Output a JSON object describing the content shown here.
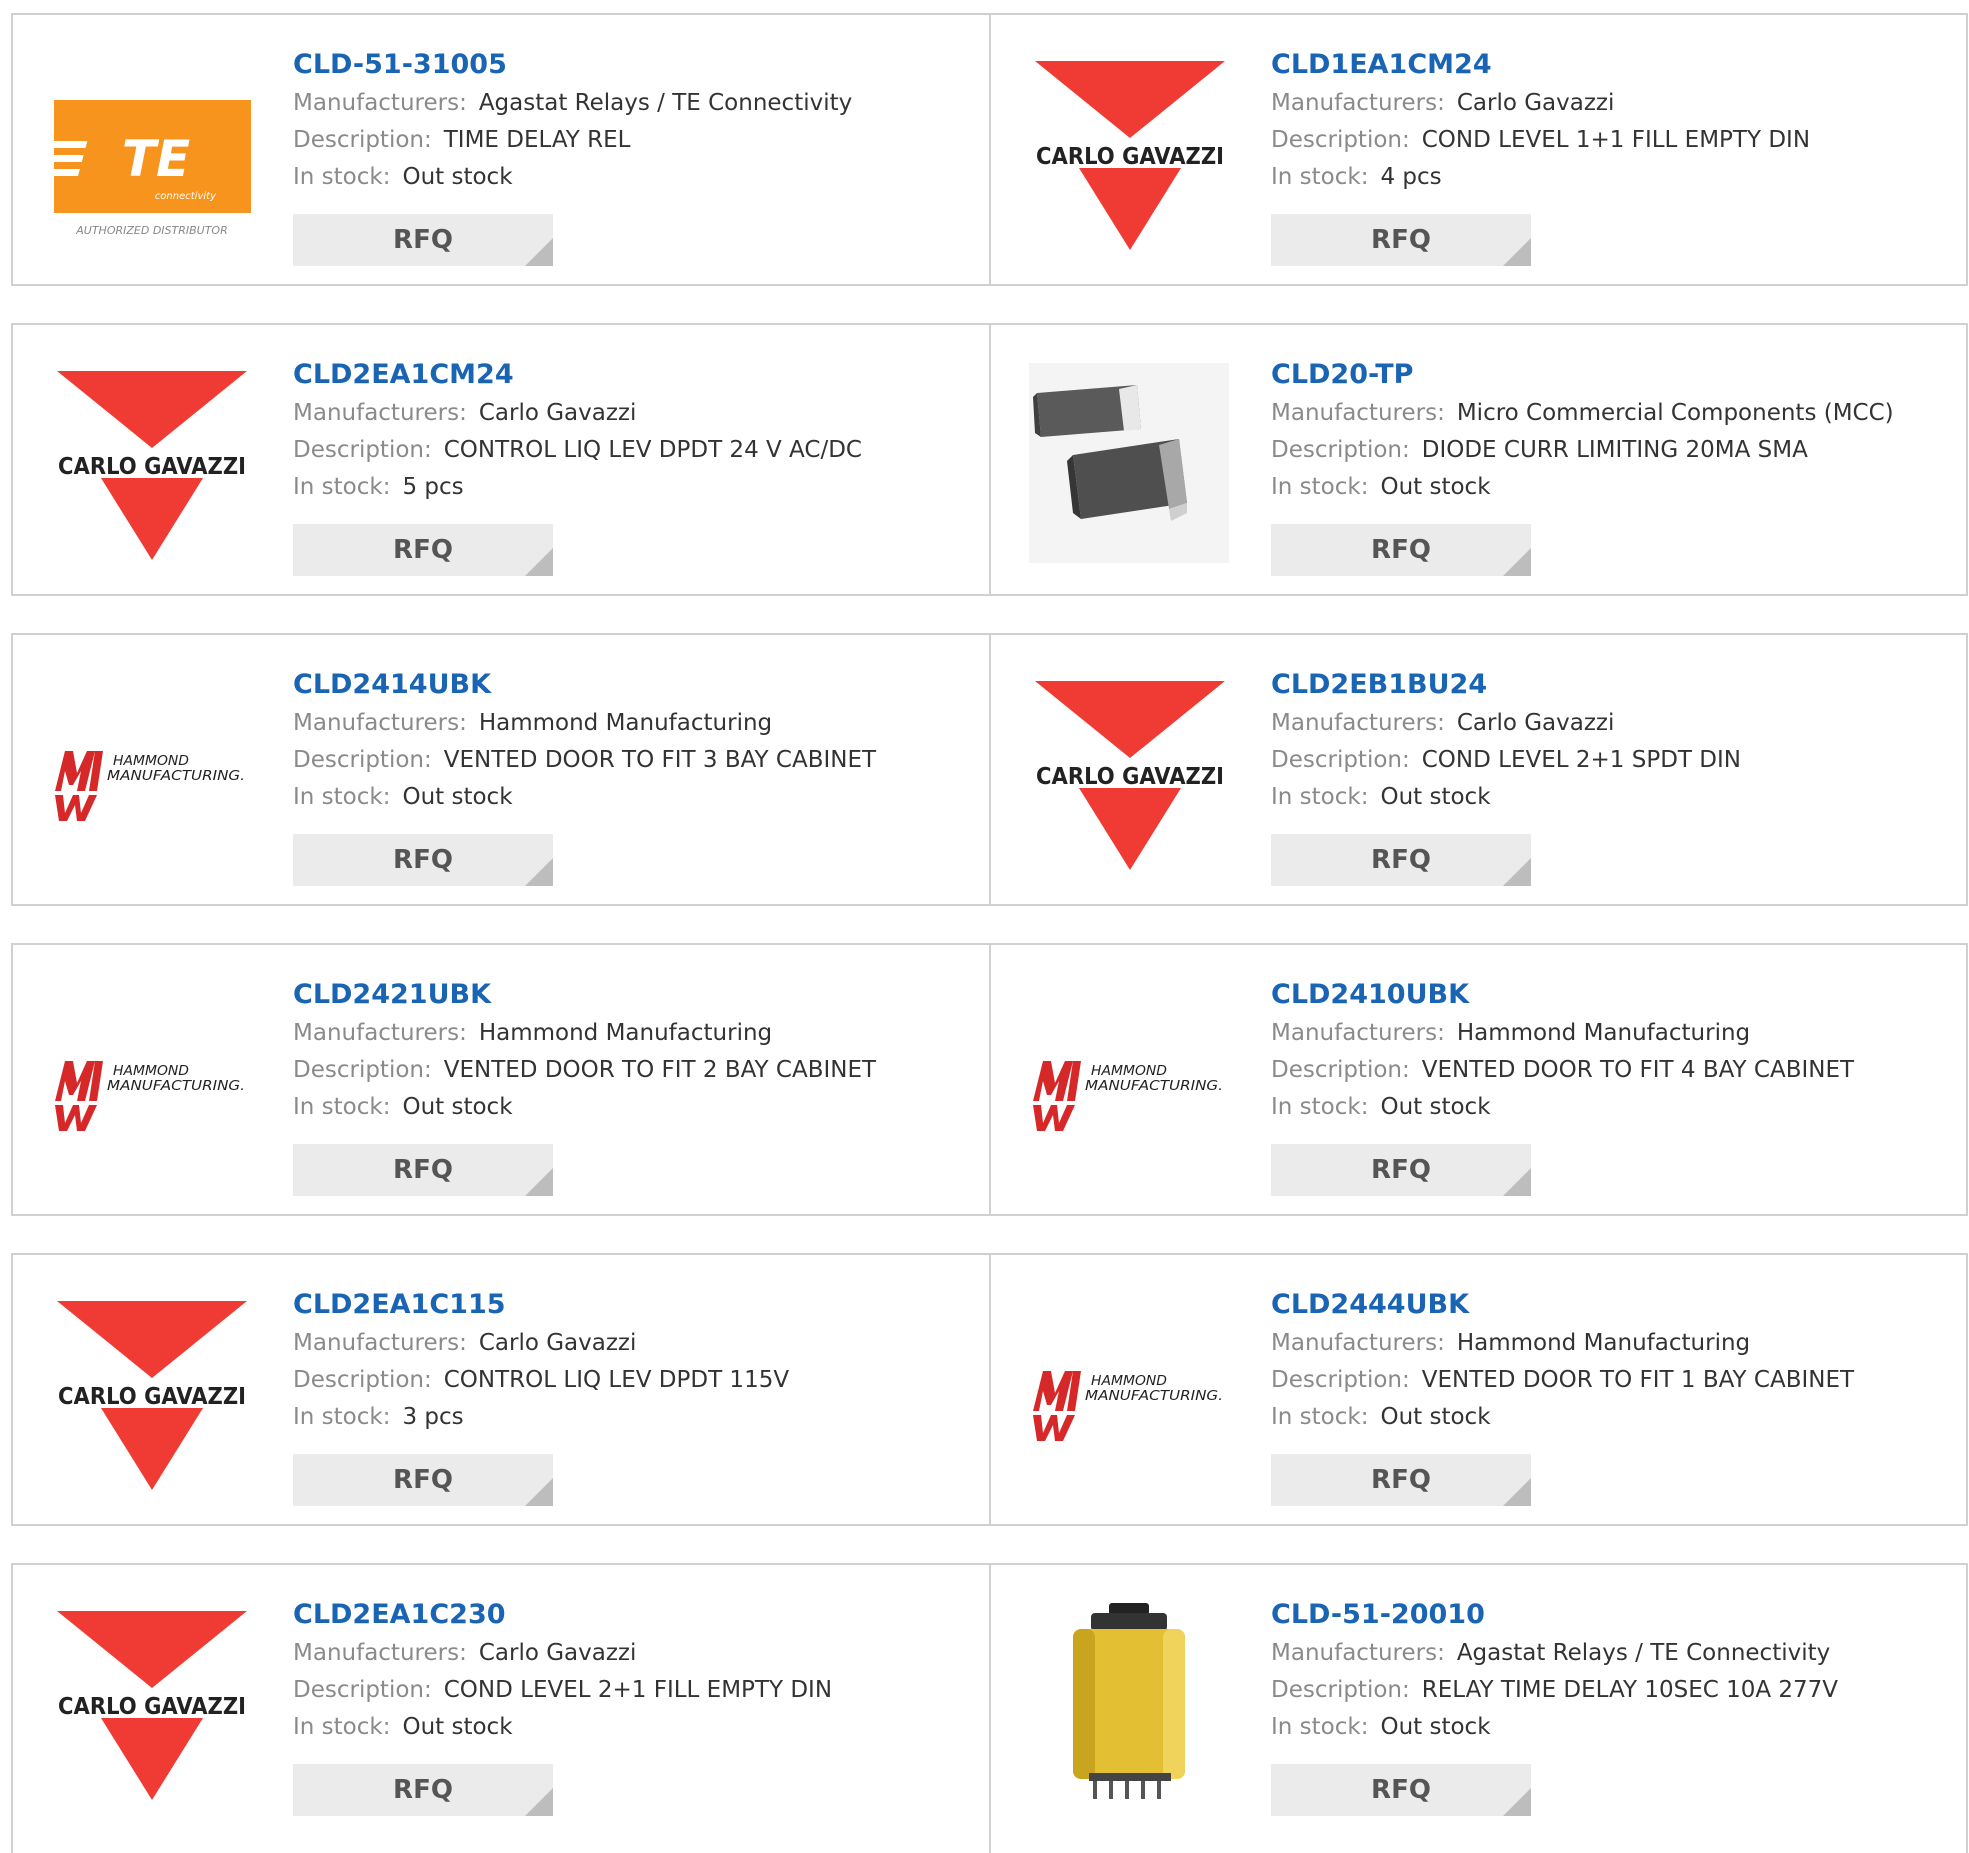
{
  "labels": {
    "manufacturers": "Manufacturers:",
    "description": "Description:",
    "in_stock": "In stock:",
    "rfq": "RFQ"
  },
  "logos": {
    "te": {
      "icon": "te-connectivity-logo",
      "mark": "TE",
      "sub": "connectivity",
      "tagline": "AUTHORIZED DISTRIBUTOR",
      "color": "#f7941d"
    },
    "carlo": {
      "icon": "carlo-gavazzi-logo",
      "text": "CARLO GAVAZZI",
      "color": "#ef3b33"
    },
    "hammond": {
      "icon": "hammond-manufacturing-logo",
      "line1": "HAMMOND",
      "line2": "MANUFACTURING.",
      "color": "#d62828"
    },
    "diode": {
      "icon": "sma-diode-image"
    },
    "relay": {
      "icon": "yellow-relay-image"
    }
  },
  "colors": {
    "link": "#1a64b4",
    "label": "#8a8a8a",
    "value": "#333333",
    "button_bg": "#ebebeb",
    "border": "#d0d0d0"
  },
  "products": [
    {
      "part": "CLD-51-31005",
      "logo": "te",
      "manufacturer": "Agastat Relays / TE Connectivity",
      "description": "TIME DELAY REL",
      "stock": "Out stock"
    },
    {
      "part": "CLD1EA1CM24",
      "logo": "carlo",
      "manufacturer": "Carlo Gavazzi",
      "description": "COND LEVEL 1+1 FILL EMPTY DIN",
      "stock": "4 pcs"
    },
    {
      "part": "CLD2EA1CM24",
      "logo": "carlo",
      "manufacturer": "Carlo Gavazzi",
      "description": "CONTROL LIQ LEV DPDT 24 V AC/DC",
      "stock": "5 pcs"
    },
    {
      "part": "CLD20-TP",
      "logo": "diode",
      "manufacturer": "Micro Commercial Components (MCC)",
      "description": "DIODE CURR LIMITING 20MA SMA",
      "stock": "Out stock"
    },
    {
      "part": "CLD2414UBK",
      "logo": "hammond",
      "manufacturer": "Hammond Manufacturing",
      "description": "VENTED DOOR TO FIT 3 BAY CABINET",
      "stock": "Out stock"
    },
    {
      "part": "CLD2EB1BU24",
      "logo": "carlo",
      "manufacturer": "Carlo Gavazzi",
      "description": "COND LEVEL 2+1 SPDT DIN",
      "stock": "Out stock"
    },
    {
      "part": "CLD2421UBK",
      "logo": "hammond",
      "manufacturer": "Hammond Manufacturing",
      "description": "VENTED DOOR TO FIT 2 BAY CABINET",
      "stock": "Out stock"
    },
    {
      "part": "CLD2410UBK",
      "logo": "hammond",
      "manufacturer": "Hammond Manufacturing",
      "description": "VENTED DOOR TO FIT 4 BAY CABINET",
      "stock": "Out stock"
    },
    {
      "part": "CLD2EA1C115",
      "logo": "carlo",
      "manufacturer": "Carlo Gavazzi",
      "description": "CONTROL LIQ LEV DPDT 115V",
      "stock": "3 pcs"
    },
    {
      "part": "CLD2444UBK",
      "logo": "hammond",
      "manufacturer": "Hammond Manufacturing",
      "description": "VENTED DOOR TO FIT 1 BAY CABINET",
      "stock": "Out stock"
    },
    {
      "part": "CLD2EA1C230",
      "logo": "carlo",
      "manufacturer": "Carlo Gavazzi",
      "description": "COND LEVEL 2+1 FILL EMPTY DIN",
      "stock": "Out stock"
    },
    {
      "part": "CLD-51-20010",
      "logo": "relay",
      "manufacturer": "Agastat Relays / TE Connectivity",
      "description": "RELAY TIME DELAY 10SEC 10A 277V",
      "stock": "Out stock"
    }
  ]
}
